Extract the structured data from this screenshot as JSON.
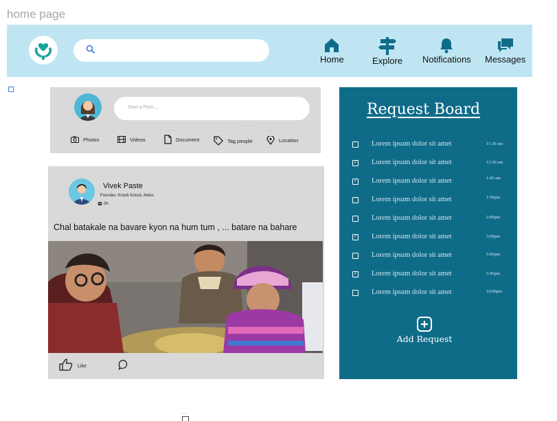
{
  "page_label": "home page",
  "header": {
    "nav": [
      {
        "label": "Home",
        "icon": "home-icon"
      },
      {
        "label": "Explore",
        "icon": "signpost-icon"
      },
      {
        "label": "Notifications",
        "icon": "bell-icon"
      },
      {
        "label": "Messages",
        "icon": "chat-icon"
      }
    ]
  },
  "composer": {
    "placeholder": "Start a Post....",
    "attachments": [
      {
        "label": "Photos",
        "icon": "camera-icon"
      },
      {
        "label": "Videos",
        "icon": "film-icon"
      },
      {
        "label": "Document",
        "icon": "document-icon"
      },
      {
        "label": "Tag people",
        "icon": "tag-icon"
      },
      {
        "label": "Location",
        "icon": "location-pin-icon"
      }
    ]
  },
  "post": {
    "author": "Vivek Paste",
    "role": "Founder, Knock Knock Jokes",
    "time": "3h",
    "text": "Chal batakale na bavare kyon na hum tum , ... batare na bahare",
    "like_label": "Like"
  },
  "request_board": {
    "title": "Request Board",
    "items": [
      {
        "text": "Lorem ipsum dolor sit amet",
        "time": "11:30 am",
        "checked": false
      },
      {
        "text": "Lorem ipsum dolor sit amet",
        "time": "12:30 am",
        "checked": true
      },
      {
        "text": "Lorem ipsum dolor sit amet",
        "time": "1:45 am",
        "checked": true
      },
      {
        "text": "Lorem ipsum dolor sit amet",
        "time": "1:50pm",
        "checked": false
      },
      {
        "text": "Lorem ipsum dolor sit amet",
        "time": "2:00pm",
        "checked": false
      },
      {
        "text": "Lorem ipsum dolor sit amet",
        "time": "3:00pm",
        "checked": true
      },
      {
        "text": "Lorem ipsum dolor sit amet",
        "time": "5:00pm",
        "checked": false
      },
      {
        "text": "Lorem ipsum dolor sit amet",
        "time": "5:45pm",
        "checked": true
      },
      {
        "text": "Lorem ipsum dolor sit amet",
        "time": "10:00pm",
        "checked": false
      }
    ],
    "add_label": "Add Request"
  },
  "colors": {
    "header_bg": "#bfe5f3",
    "board_bg": "#0f6c89",
    "card_bg": "#d9d9d9",
    "logo_teal": "#1aa39a"
  }
}
